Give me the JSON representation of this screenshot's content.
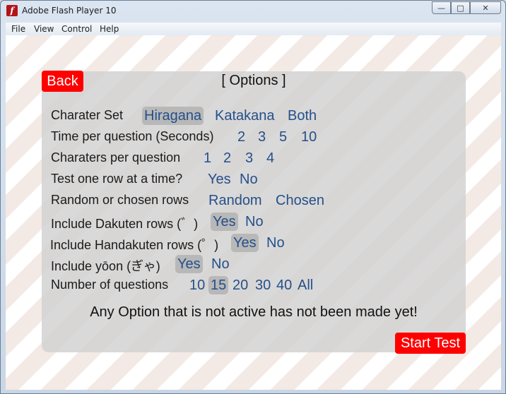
{
  "window": {
    "title": "Adobe Flash Player 10",
    "buttons": {
      "minimize": "—",
      "maximize": "□",
      "close": "✕"
    }
  },
  "menu": [
    "File",
    "View",
    "Control",
    "Help"
  ],
  "panel": {
    "back_label": "Back",
    "title": "[ Options ]",
    "rows": [
      {
        "label": "Charater Set",
        "options": [
          "Hiragana",
          "Katakana",
          "Both"
        ],
        "selected": 0
      },
      {
        "label": "Time per question (Seconds)",
        "options": [
          "2",
          "3",
          "5",
          "10"
        ],
        "selected": null
      },
      {
        "label": "Charaters per question",
        "options": [
          "1",
          "2",
          "3",
          "4"
        ],
        "selected": null
      },
      {
        "label": "Test one row at a time?",
        "options": [
          "Yes",
          "No"
        ],
        "selected": null
      },
      {
        "label": "Random or chosen rows",
        "options": [
          "Random",
          "Chosen"
        ],
        "selected": null
      },
      {
        "label": "Include Dakuten rows (゛)",
        "options": [
          "Yes",
          "No"
        ],
        "selected": 0
      },
      {
        "label": "Include Handakuten rows (゜)",
        "options": [
          "Yes",
          "No"
        ],
        "selected": 0
      },
      {
        "label": "Include yōon (ぎゃ)",
        "options": [
          "Yes",
          "No"
        ],
        "selected": 0
      },
      {
        "label": "Number of questions",
        "options": [
          "10",
          "15",
          "20",
          "30",
          "40",
          "All"
        ],
        "selected": 1
      }
    ],
    "notice": "Any Option that is not active has not been made yet!",
    "start_label": "Start Test"
  },
  "colors": {
    "accent_red": "#ff0000",
    "option_blue": "#24508a",
    "selected_bg": "#b8b8b8"
  },
  "icons": [
    "flash-player-icon",
    "minimize-icon",
    "maximize-icon",
    "close-icon"
  ]
}
